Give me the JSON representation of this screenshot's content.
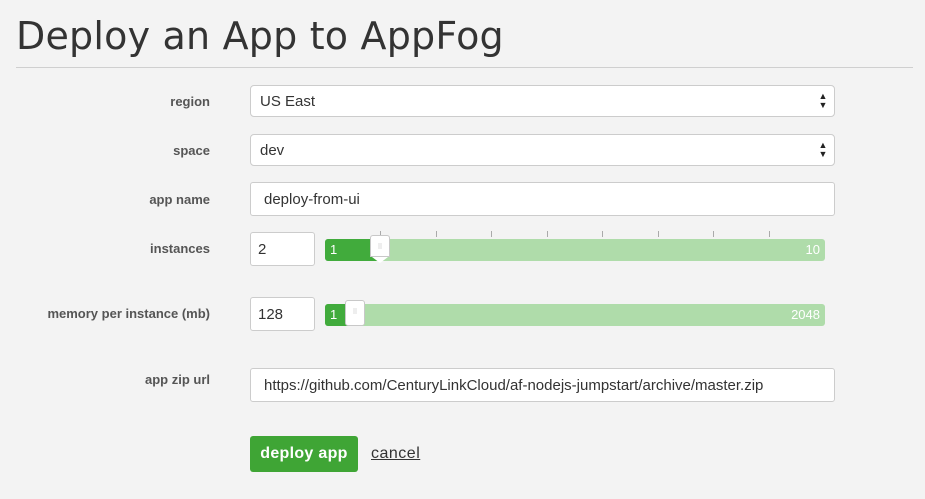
{
  "page": {
    "title": "Deploy an App to AppFog"
  },
  "form": {
    "region": {
      "label": "region",
      "value": "US East"
    },
    "space": {
      "label": "space",
      "value": "dev"
    },
    "app_name": {
      "label": "app name",
      "value": "deploy-from-ui"
    },
    "instances": {
      "label": "instances",
      "value": "2",
      "slider_min": "1",
      "slider_max": "10",
      "slider_level": 0.11
    },
    "memory": {
      "label": "memory per instance (mb)",
      "value": "128",
      "slider_min": "1",
      "slider_max": "2048",
      "slider_level": 0.06
    },
    "app_zip_url": {
      "label": "app zip url",
      "value": "https://github.com/CenturyLinkCloud/af-nodejs-jumpstart/archive/master.zip"
    }
  },
  "actions": {
    "deploy_label": "deploy app",
    "cancel_label": "cancel"
  },
  "colors": {
    "primary_green": "#3fa535",
    "slider_track": "#afdcaa",
    "background": "#f3f3f3"
  }
}
